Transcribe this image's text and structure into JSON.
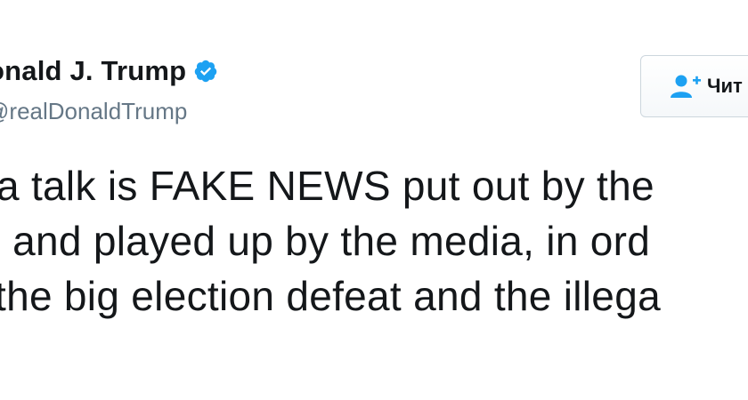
{
  "author": {
    "display_name": "onald J. Trump",
    "handle": "realDonaldTrump",
    "verified_icon": "verified-badge-icon",
    "verified_color": "#1da1f2"
  },
  "follow": {
    "label": "Чит",
    "icon": "add-user-icon",
    "icon_color": "#1da1f2"
  },
  "tweet": {
    "lines": [
      "a talk is FAKE NEWS put out by the",
      ", and played up by the media, in ord",
      "the big election defeat and the illega"
    ]
  }
}
